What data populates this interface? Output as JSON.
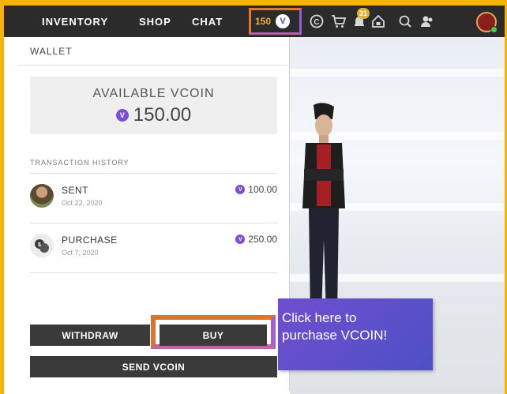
{
  "nav": {
    "links": [
      "INVENTORY",
      "SHOP",
      "CHAT"
    ],
    "credit_amount": "150",
    "notification_count": "31"
  },
  "wallet": {
    "title": "WALLET",
    "balance_label": "AVAILABLE VCOIN",
    "balance_value": "150.00",
    "history_label": "TRANSACTION HISTORY",
    "transactions": [
      {
        "type": "SENT",
        "date": "Oct 22, 2020",
        "amount": "100.00"
      },
      {
        "type": "PURCHASE",
        "date": "Oct 7, 2020",
        "amount": "250.00"
      }
    ],
    "buttons": {
      "withdraw": "WITHDRAW",
      "buy": "BUY",
      "send": "SEND VCOIN"
    }
  },
  "tooltip": {
    "line1": "Click here to",
    "line2": "purchase VCOIN!"
  },
  "colors": {
    "accent_purple": "#7b4fd3",
    "frame_yellow": "#f5b400",
    "highlight_orange": "#d9762e",
    "dark_button": "#3a3a3a"
  }
}
